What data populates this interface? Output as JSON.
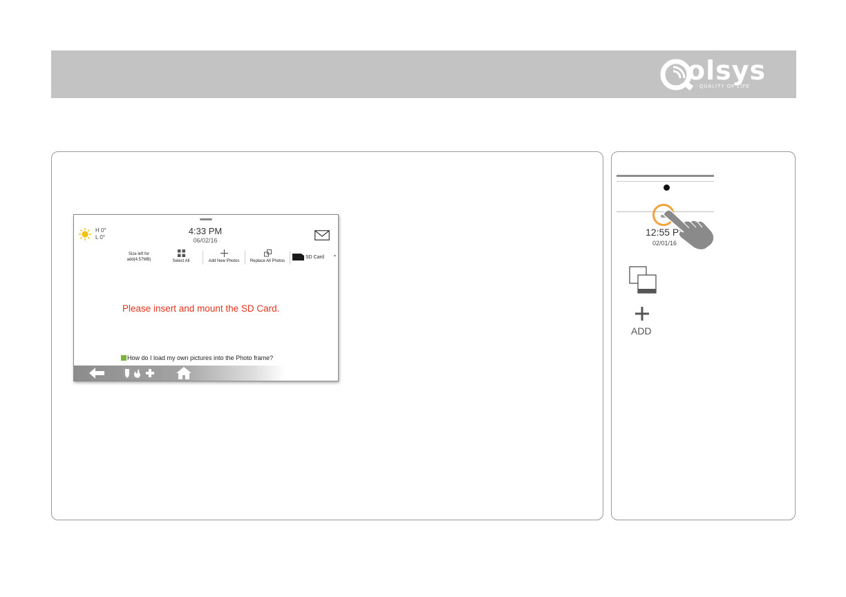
{
  "brand": {
    "name": "olsys",
    "tagline": "QUALITY OF LIFE"
  },
  "device_screen": {
    "weather": {
      "high": "H 0°",
      "low": "L 0°",
      "icon": "sun-icon"
    },
    "clock": {
      "time": "4:33 PM",
      "date": "06/02/16"
    },
    "toolbar": {
      "size_left": "Size left for add(4.57MB)",
      "select_all": "Select All",
      "add_new_photos": "Add New Photos",
      "replace_all_photos": "Replace All Photos",
      "storage_selected": "SD Card"
    },
    "message": "Please insert and mount the SD Card.",
    "help_link": "How do I load my own pictures into the Photo frame?",
    "colors": {
      "message": "#e3341e",
      "help_icon": "#79b53a"
    }
  },
  "side_panel": {
    "time": "12:55 PM",
    "date": "02/01/16",
    "add_label": "ADD",
    "ring_color": "#f2a23d"
  }
}
